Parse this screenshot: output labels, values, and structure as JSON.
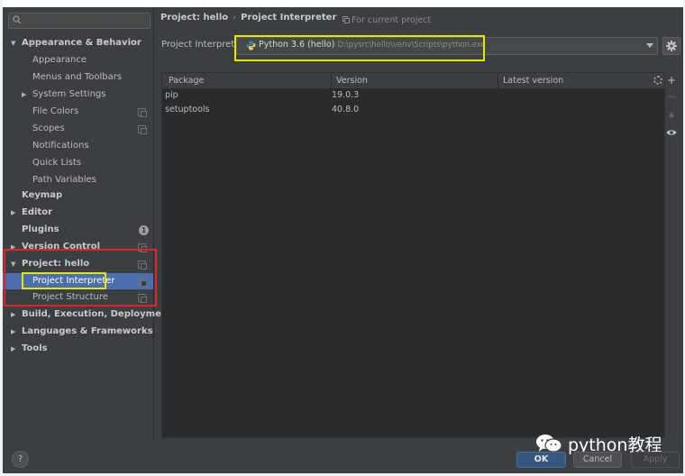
{
  "sidebar": {
    "search": {
      "placeholder": "Q▾"
    },
    "items": [
      {
        "label": "Appearance & Behavior",
        "bold": true,
        "arrow": "▼"
      },
      {
        "label": "Appearance"
      },
      {
        "label": "Menus and Toolbars"
      },
      {
        "label": "System Settings",
        "arrow": "▶"
      },
      {
        "label": "File Colors"
      },
      {
        "label": "Scopes"
      },
      {
        "label": "Notifications"
      },
      {
        "label": "Quick Lists"
      },
      {
        "label": "Path Variables"
      },
      {
        "label": "Keymap",
        "bold": true
      },
      {
        "label": "Editor",
        "bold": true,
        "arrow": "▶"
      },
      {
        "label": "Plugins",
        "bold": true,
        "badge": "1"
      },
      {
        "label": "Version Control",
        "bold": true,
        "arrow": "▶"
      },
      {
        "label": "Project: hello",
        "bold": true,
        "arrow": "▼"
      },
      {
        "label": "Project Interpreter",
        "selected": true
      },
      {
        "label": "Project Structure"
      },
      {
        "label": "Build, Execution, Deployment",
        "bold": true,
        "arrow": "▶"
      },
      {
        "label": "Languages & Frameworks",
        "bold": true,
        "arrow": "▶"
      },
      {
        "label": "Tools",
        "bold": true,
        "arrow": "▶"
      }
    ]
  },
  "breadcrumb": {
    "root": "Project: hello",
    "separator": "›",
    "page": "Project Interpreter"
  },
  "for_current_project": "For current project",
  "interpreter": {
    "label": "Project Interpreter:",
    "name": "Python 3.6 (hello)",
    "path": "D:\\pysrc\\hello\\venv\\Scripts\\python.exe"
  },
  "table": {
    "headers": [
      "Package",
      "Version",
      "Latest version"
    ],
    "rows": [
      {
        "package": "pip",
        "version": "19.0.3",
        "latest": ""
      },
      {
        "package": "setuptools",
        "version": "40.8.0",
        "latest": ""
      }
    ]
  },
  "tools": {
    "add": "+",
    "remove": "−",
    "upgrade": "▲",
    "show": "eye"
  },
  "buttons": {
    "help": "?",
    "ok": "OK",
    "cancel": "Cancel",
    "apply": "Apply"
  },
  "watermark": {
    "text": "python教程"
  },
  "colors": {
    "accent": "#4b6eaf",
    "highlight_red": "#e0242a",
    "highlight_yellow": "#e6e600"
  }
}
